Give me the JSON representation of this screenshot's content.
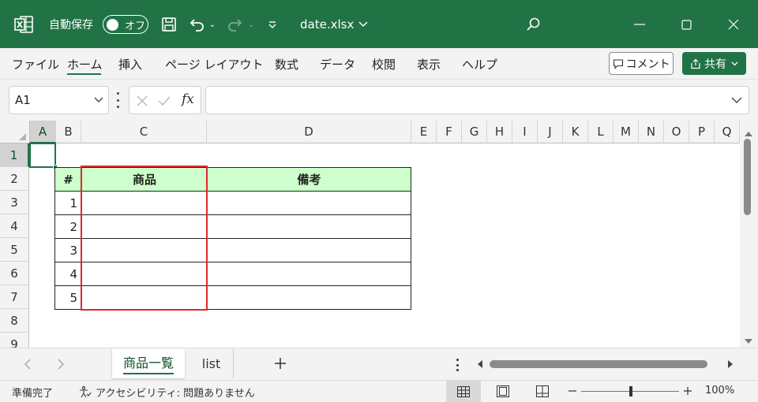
{
  "app": {
    "autosave_label": "自動保存",
    "autosave_state": "オフ",
    "filename": "date.xlsx",
    "accent": "#217346"
  },
  "menu": {
    "items": [
      "ファイル",
      "ホーム",
      "挿入",
      "ページ レイアウト",
      "数式",
      "データ",
      "校閲",
      "表示",
      "ヘルプ"
    ],
    "active": "ホーム",
    "comment_label": "コメント",
    "share_label": "共有"
  },
  "formula": {
    "name_box": "A1",
    "fx": "fx",
    "content": ""
  },
  "columns": [
    "A",
    "B",
    "C",
    "D",
    "E",
    "F",
    "G",
    "H",
    "I",
    "J",
    "K",
    "L",
    "M",
    "N",
    "O",
    "P",
    "Q"
  ],
  "rows": [
    "1",
    "2",
    "3",
    "4",
    "5",
    "6",
    "7",
    "8",
    "9"
  ],
  "table": {
    "headers": [
      "#",
      "商品",
      "備考"
    ],
    "header_fill": "#ccffcc",
    "numbers": [
      "1",
      "2",
      "3",
      "4",
      "5"
    ],
    "highlight_color": "#e0282e"
  },
  "sheets": {
    "tabs": [
      "商品一覧",
      "list"
    ],
    "active": "商品一覧"
  },
  "status": {
    "ready": "準備完了",
    "accessibility": "アクセシビリティ: 問題ありません",
    "zoom": "100%"
  }
}
